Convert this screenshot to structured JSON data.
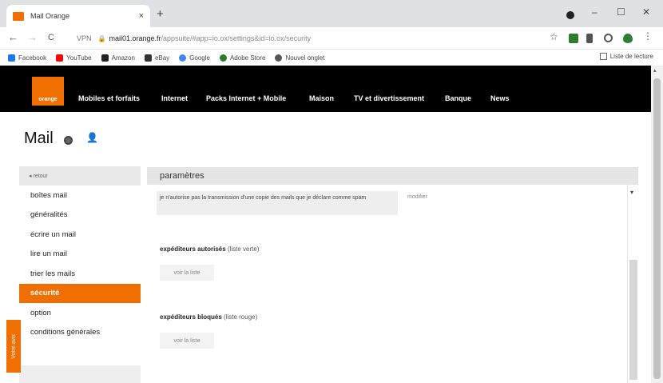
{
  "browser": {
    "tab_title": "Mail Orange",
    "tab_close": "×",
    "new_tab": "+",
    "window_controls": {
      "minimize": "–",
      "maximize": "☐",
      "close": "✕"
    },
    "nav": {
      "back": "←",
      "forward": "→",
      "reload": "C"
    },
    "vpn": "VPN",
    "url_host": "mail01.orange.fr",
    "url_path": "/appsuite/#app=io.ox/settings&id=io.ox/security",
    "bookmarks": [
      {
        "label": "Facebook",
        "color": "#1877f2"
      },
      {
        "label": "YouTube",
        "color": "#ff0000"
      },
      {
        "label": "Amazon",
        "color": "#222222"
      },
      {
        "label": "eBay",
        "color": "#333333"
      },
      {
        "label": "Google",
        "color": "#4285f4"
      },
      {
        "label": "Adobe Store",
        "color": "#2b7a2b"
      },
      {
        "label": "Nouvel onglet",
        "color": "#555555"
      }
    ],
    "reading_list": "Liste de lecture"
  },
  "site": {
    "logo_text": "orange",
    "brand_color": "#f16e00",
    "nav_items": [
      "Mobiles et forfaits",
      "Internet",
      "Packs Internet + Mobile",
      "Maison",
      "TV et divertissement",
      "Banque",
      "News"
    ]
  },
  "mail": {
    "title": "Mail"
  },
  "sidebar": {
    "back": "◂  retour",
    "items": [
      {
        "label": "boîtes mail",
        "active": false
      },
      {
        "label": "généralités",
        "active": false
      },
      {
        "label": "écrire un mail",
        "active": false
      },
      {
        "label": "lire un mail",
        "active": false
      },
      {
        "label": "trier les mails",
        "active": false
      },
      {
        "label": "sécurité",
        "active": true
      },
      {
        "label": "option",
        "active": false
      },
      {
        "label": "conditions générales",
        "active": false
      }
    ],
    "feedback": "Votre avis"
  },
  "main": {
    "header": "paramètres",
    "policy_text": "je n'autorise pas la transmission d'une copie des mails que je déclare comme spam",
    "modify": "modifier",
    "whitelist": {
      "title": "expéditeurs autorisés",
      "subtitle": "(liste verte)",
      "button": "voir la liste"
    },
    "blacklist": {
      "title": "expéditeurs bloqués",
      "subtitle": "(liste rouge)",
      "button": "voir la liste"
    }
  }
}
